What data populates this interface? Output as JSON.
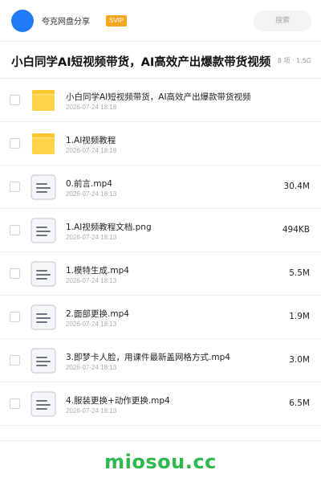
{
  "header": {
    "username": "夸克网盘分享",
    "badge": "SVIP",
    "search_placeholder": "搜索"
  },
  "folder": {
    "title": "小白同学AI短视频带货，AI高效产出爆款带货视频",
    "meta": "8 项 · 1.5G"
  },
  "files": [
    {
      "type": "folder",
      "icon": "folder-icon",
      "name": "小白同学AI短视频带货，AI高效产出爆款带货视频",
      "date": "2026-07-24 18:18",
      "size": ""
    },
    {
      "type": "folder",
      "icon": "folder-icon",
      "name": "1.AI视频教程",
      "date": "2026-07-24 18:18",
      "size": ""
    },
    {
      "type": "file",
      "icon": "file-icon",
      "name": "0.前言.mp4",
      "date": "2026-07-24 18:13",
      "size": "30.4M"
    },
    {
      "type": "file",
      "icon": "file-icon",
      "name": "1.AI视频教程文档.png",
      "date": "2026-07-24 18:13",
      "size": "494KB"
    },
    {
      "type": "file",
      "icon": "file-icon",
      "name": "1.模特生成.mp4",
      "date": "2026-07-24 18:13",
      "size": "5.5M"
    },
    {
      "type": "file",
      "icon": "file-icon",
      "name": "2.面部更换.mp4",
      "date": "2026-07-24 18:13",
      "size": "1.9M"
    },
    {
      "type": "file",
      "icon": "file-icon",
      "name": "3.即梦卡人脸，用课件最新盖网格方式.mp4",
      "date": "2026-07-24 18:13",
      "size": "3.0M"
    },
    {
      "type": "file",
      "icon": "file-icon",
      "name": "4.服装更换+动作更换.mp4",
      "date": "2026-07-24 18:13",
      "size": "6.5M"
    }
  ],
  "footer": {
    "watermark": "miosou.cc"
  },
  "colors": {
    "accent_blue": "#1e7bf5",
    "svip_orange": "#f5a51e",
    "folder_yellow": "#fcd34a",
    "watermark_green": "#2fb84e"
  }
}
